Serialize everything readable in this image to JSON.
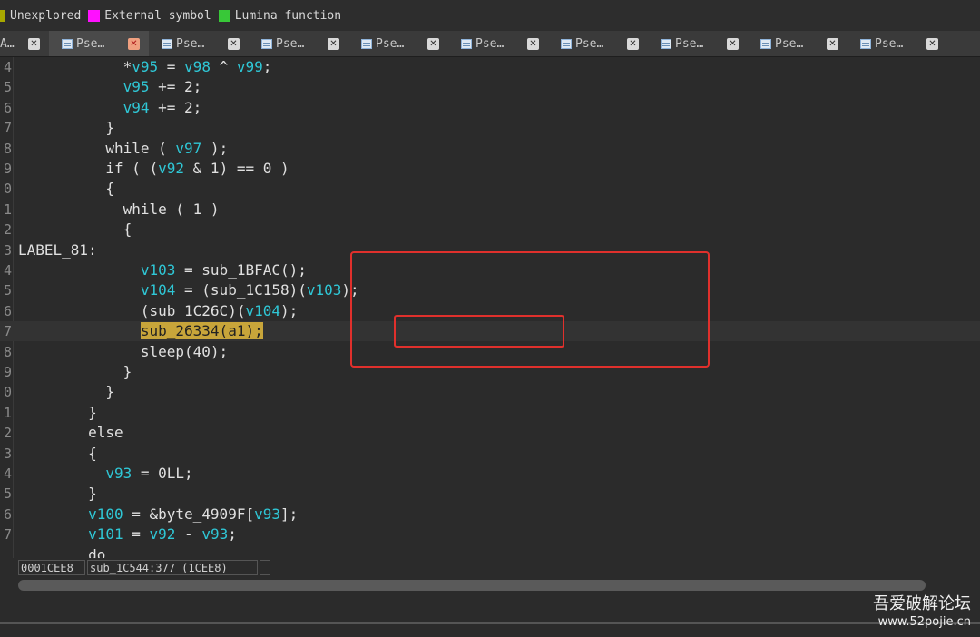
{
  "legend": {
    "items": [
      {
        "label": "Unexplored",
        "color": "#a8a800"
      },
      {
        "label": "External symbol",
        "color": "#ff10ff"
      },
      {
        "label": "Lumina function",
        "color": "#38c838"
      }
    ]
  },
  "tabs": [
    {
      "label": "A…"
    },
    {
      "label": "Pse…",
      "active": true
    },
    {
      "label": "Pse…"
    },
    {
      "label": "Pse…"
    },
    {
      "label": "Pse…"
    },
    {
      "label": "Pse…"
    },
    {
      "label": "Pse…"
    },
    {
      "label": "Pse…"
    },
    {
      "label": "Pse…"
    },
    {
      "label": "Pse…"
    }
  ],
  "code": {
    "lines": [
      {
        "ln": "4",
        "text": "            *v95 = v98 ^ v99;"
      },
      {
        "ln": "5",
        "text": "            v95 += 2;"
      },
      {
        "ln": "6",
        "text": "            v94 += 2;"
      },
      {
        "ln": "7",
        "text": "          }"
      },
      {
        "ln": "8",
        "text": "          while ( v97 );"
      },
      {
        "ln": "9",
        "text": "          if ( (v92 & 1) == 0 )"
      },
      {
        "ln": "0",
        "text": "          {"
      },
      {
        "ln": "1",
        "text": "            while ( 1 )"
      },
      {
        "ln": "2",
        "text": "            {"
      },
      {
        "ln": "3",
        "text": "LABEL_81:"
      },
      {
        "ln": "4",
        "text": "              v103 = sub_1BFAC();"
      },
      {
        "ln": "5",
        "text": "              v104 = (sub_1C158)(v103);"
      },
      {
        "ln": "6",
        "text": "              (sub_1C26C)(v104);"
      },
      {
        "ln": "7",
        "text": "              sub_26334(a1);"
      },
      {
        "ln": "8",
        "text": "              sleep(40);"
      },
      {
        "ln": "9",
        "text": "            }"
      },
      {
        "ln": "0",
        "text": "          }"
      },
      {
        "ln": "1",
        "text": "        }"
      },
      {
        "ln": "2",
        "text": "        else"
      },
      {
        "ln": "3",
        "text": "        {"
      },
      {
        "ln": "4",
        "text": "          v93 = 0LL;"
      },
      {
        "ln": "5",
        "text": "        }"
      },
      {
        "ln": "6",
        "text": "        v100 = &byte_4909F[v93];"
      },
      {
        "ln": "7",
        "text": "        v101 = v92 - v93;"
      },
      {
        "ln": "",
        "text": "        do"
      }
    ],
    "highlighted_call": "sub_26334(a1);"
  },
  "status": {
    "address": "0001CEE8",
    "location": "sub_1C544:377 (1CEE8)"
  },
  "watermark": {
    "line1": "吾爱破解论坛",
    "line2": "www.52pojie.cn"
  }
}
